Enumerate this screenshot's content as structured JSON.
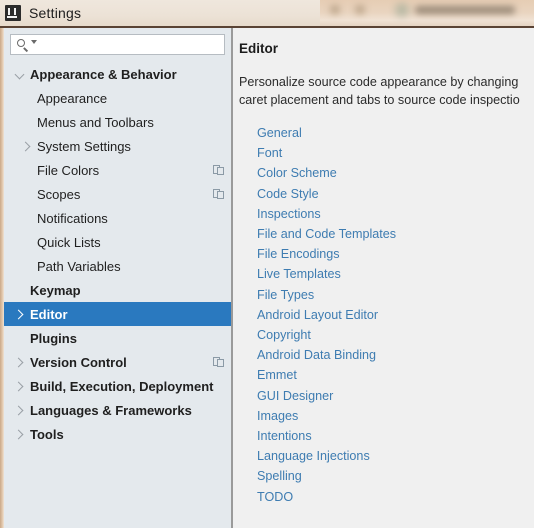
{
  "window": {
    "title": "Settings",
    "app_icon": "intellij-idea-icon"
  },
  "sidebar": {
    "search": {
      "value": "",
      "placeholder": "",
      "icon": "search-icon",
      "dropdown_icon": "caret-down-icon"
    },
    "items": [
      {
        "label": "Appearance & Behavior",
        "level": 0,
        "bold": true,
        "twisty": "down",
        "selected": false,
        "copy_icon": false
      },
      {
        "label": "Appearance",
        "level": 1,
        "bold": false,
        "twisty": "none",
        "selected": false,
        "copy_icon": false
      },
      {
        "label": "Menus and Toolbars",
        "level": 1,
        "bold": false,
        "twisty": "none",
        "selected": false,
        "copy_icon": false
      },
      {
        "label": "System Settings",
        "level": 1,
        "bold": false,
        "twisty": "right",
        "selected": false,
        "copy_icon": false
      },
      {
        "label": "File Colors",
        "level": 1,
        "bold": false,
        "twisty": "none",
        "selected": false,
        "copy_icon": true
      },
      {
        "label": "Scopes",
        "level": 1,
        "bold": false,
        "twisty": "none",
        "selected": false,
        "copy_icon": true
      },
      {
        "label": "Notifications",
        "level": 1,
        "bold": false,
        "twisty": "none",
        "selected": false,
        "copy_icon": false
      },
      {
        "label": "Quick Lists",
        "level": 1,
        "bold": false,
        "twisty": "none",
        "selected": false,
        "copy_icon": false
      },
      {
        "label": "Path Variables",
        "level": 1,
        "bold": false,
        "twisty": "none",
        "selected": false,
        "copy_icon": false
      },
      {
        "label": "Keymap",
        "level": 0,
        "bold": true,
        "twisty": "none",
        "selected": false,
        "copy_icon": false
      },
      {
        "label": "Editor",
        "level": 0,
        "bold": true,
        "twisty": "right",
        "selected": true,
        "copy_icon": false
      },
      {
        "label": "Plugins",
        "level": 0,
        "bold": true,
        "twisty": "none",
        "selected": false,
        "copy_icon": false
      },
      {
        "label": "Version Control",
        "level": 0,
        "bold": true,
        "twisty": "right",
        "selected": false,
        "copy_icon": true
      },
      {
        "label": "Build, Execution, Deployment",
        "level": 0,
        "bold": true,
        "twisty": "right",
        "selected": false,
        "copy_icon": false
      },
      {
        "label": "Languages & Frameworks",
        "level": 0,
        "bold": true,
        "twisty": "right",
        "selected": false,
        "copy_icon": false
      },
      {
        "label": "Tools",
        "level": 0,
        "bold": true,
        "twisty": "right",
        "selected": false,
        "copy_icon": false
      }
    ]
  },
  "content": {
    "title": "Editor",
    "description": "Personalize source code appearance by changing\ncaret placement and tabs to source code inspectio",
    "links": [
      "General",
      "Font",
      "Color Scheme",
      "Code Style",
      "Inspections",
      "File and Code Templates",
      "File Encodings",
      "Live Templates",
      "File Types",
      "Android Layout Editor",
      "Copyright",
      "Android Data Binding",
      "Emmet",
      "GUI Designer",
      "Images",
      "Intentions",
      "Language Injections",
      "Spelling",
      "TODO"
    ]
  },
  "colors": {
    "selection_blue": "#2a79bf",
    "link_blue": "#3e7cb1",
    "sidebar_bg": "#e4e9ed",
    "content_bg": "#f0f0f0",
    "titlebar_bg": "#ece2d6"
  }
}
